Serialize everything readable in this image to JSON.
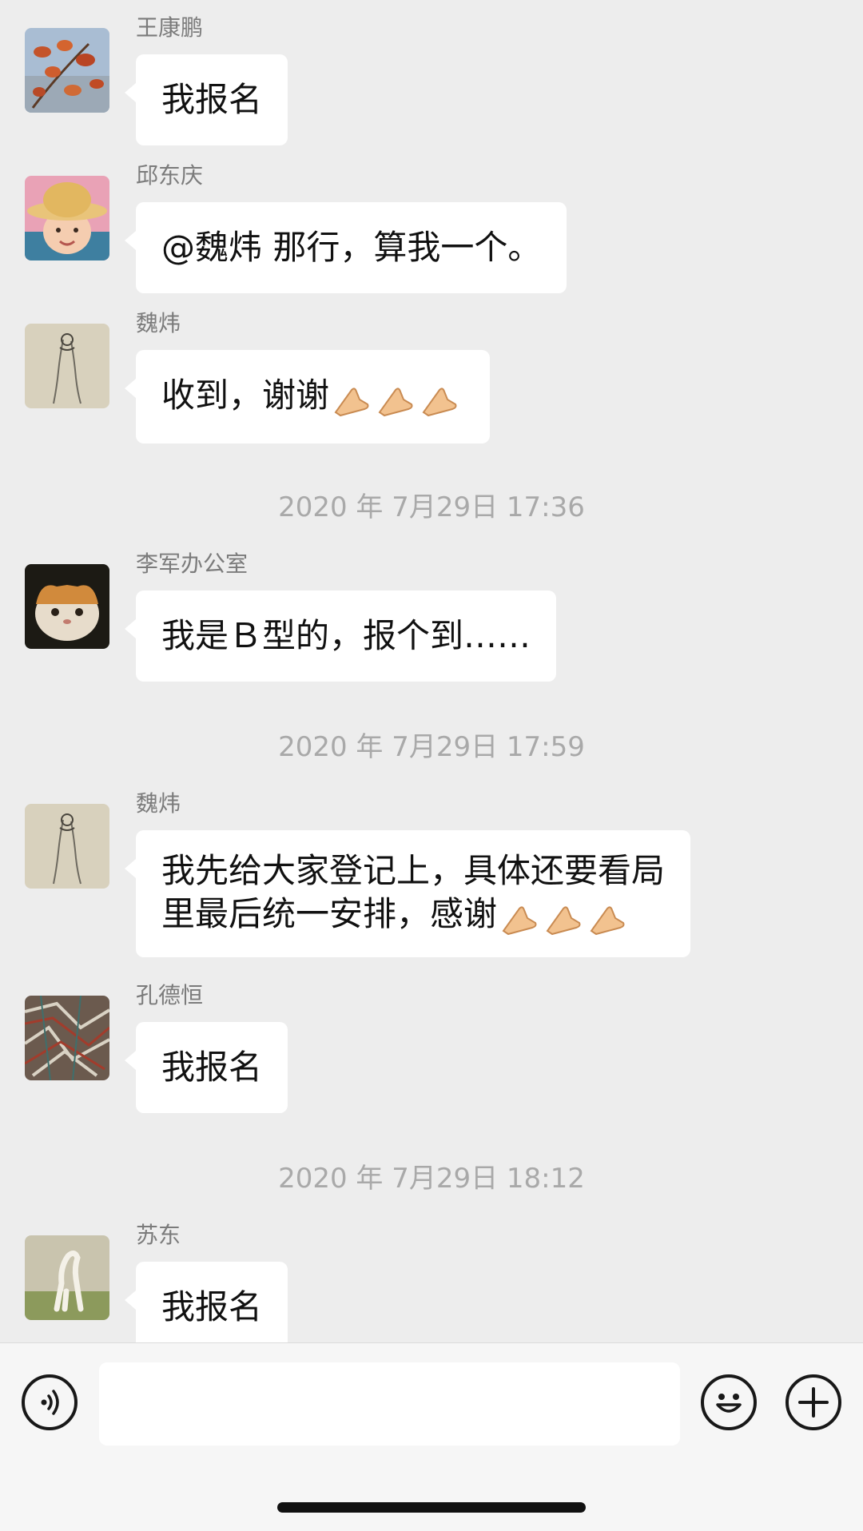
{
  "messages": [
    {
      "sender": "王康鹏",
      "lines": [
        "我报名"
      ],
      "avatar": "autumn-leaves-avatar"
    },
    {
      "sender": "邱东庆",
      "lines": [
        "@魏炜 那行，算我一个。"
      ],
      "avatar": "child-straw-hat-avatar"
    },
    {
      "sender": "魏炜",
      "lines": [
        "收到，谢谢"
      ],
      "hands": 3,
      "avatar": "ink-sketch-avatar"
    },
    {
      "sender": "李军办公室",
      "lines": [
        "我是Ｂ型的，报个到……"
      ],
      "avatar": "cat-avatar"
    },
    {
      "sender": "魏炜",
      "lines": [
        "我先给大家登记上，具体还要看局",
        "里最后统一安排，感谢"
      ],
      "hands": 3,
      "avatar": "ink-sketch-avatar"
    },
    {
      "sender": "孔德恒",
      "lines": [
        "我报名"
      ],
      "avatar": "abstract-art-avatar"
    },
    {
      "sender": "苏东",
      "lines": [
        "我报名"
      ],
      "avatar": "white-horse-avatar"
    }
  ],
  "timestamps": [
    "2020 年 7月29日 17:36",
    "2020 年 7月29日 17:59",
    "2020 年 7月29日 18:12"
  ],
  "toolbar": {
    "voice_icon": "voice-icon",
    "emoji_icon": "emoji-icon",
    "plus_icon": "plus-icon",
    "input_value": ""
  },
  "colors": {
    "background": "#ededed",
    "bubble": "#ffffff",
    "timestamp": "#a9a9a9",
    "sender": "#7b7b7b"
  }
}
